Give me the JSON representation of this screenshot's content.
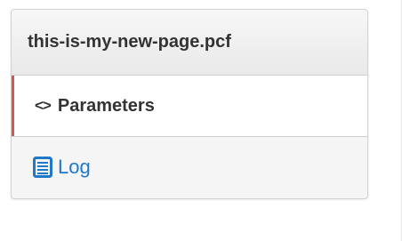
{
  "panel": {
    "title": "this-is-my-new-page.pcf",
    "items": [
      {
        "label": "Parameters",
        "icon": "code-icon",
        "active": true
      },
      {
        "label": "Log",
        "icon": "document-icon",
        "active": false
      }
    ],
    "active_accent_color": "#d9534f",
    "link_color": "#1f78c8"
  }
}
